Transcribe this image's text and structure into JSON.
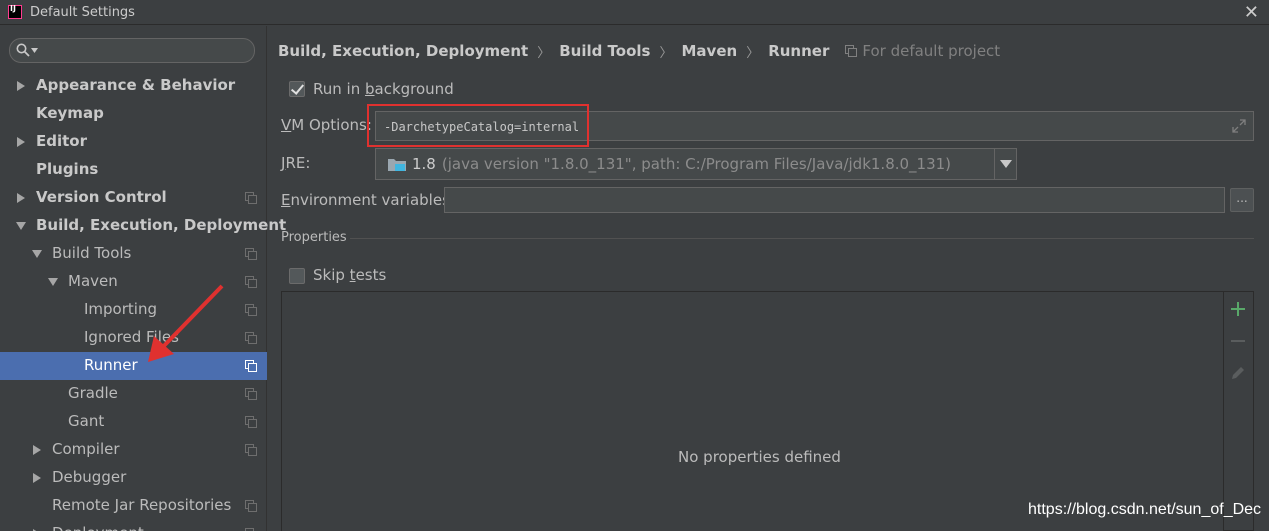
{
  "window": {
    "title": "Default Settings",
    "close_glyph": "✕"
  },
  "search": {
    "placeholder": ""
  },
  "sidebar": {
    "items": [
      {
        "label": "Appearance & Behavior",
        "bold": true,
        "arrow": "right",
        "shared": false
      },
      {
        "label": "Keymap",
        "bold": true,
        "arrow": "none",
        "shared": false
      },
      {
        "label": "Editor",
        "bold": true,
        "arrow": "right",
        "shared": false
      },
      {
        "label": "Plugins",
        "bold": true,
        "arrow": "none",
        "shared": false
      },
      {
        "label": "Version Control",
        "bold": true,
        "arrow": "right",
        "shared": true
      },
      {
        "label": "Build, Execution, Deployment",
        "bold": true,
        "arrow": "down",
        "shared": false
      },
      {
        "label": "Build Tools",
        "bold": false,
        "arrow": "down",
        "shared": true
      },
      {
        "label": "Maven",
        "bold": false,
        "arrow": "down",
        "shared": true
      },
      {
        "label": "Importing",
        "bold": false,
        "arrow": "none",
        "shared": true
      },
      {
        "label": "Ignored Files",
        "bold": false,
        "arrow": "none",
        "shared": true
      },
      {
        "label": "Runner",
        "bold": false,
        "arrow": "none",
        "shared": true,
        "selected": true
      },
      {
        "label": "Gradle",
        "bold": false,
        "arrow": "none",
        "shared": true
      },
      {
        "label": "Gant",
        "bold": false,
        "arrow": "none",
        "shared": true
      },
      {
        "label": "Compiler",
        "bold": false,
        "arrow": "right",
        "shared": true
      },
      {
        "label": "Debugger",
        "bold": false,
        "arrow": "right",
        "shared": false
      },
      {
        "label": "Remote Jar Repositories",
        "bold": false,
        "arrow": "none",
        "shared": true
      },
      {
        "label": "Deployment",
        "bold": false,
        "arrow": "right",
        "shared": true
      }
    ]
  },
  "breadcrumb": {
    "parts": [
      "Build, Execution, Deployment",
      "Build Tools",
      "Maven",
      "Runner"
    ],
    "separator": "〉",
    "scope": "For default project"
  },
  "form": {
    "run_in_background": {
      "pre": "Run in ",
      "underlined": "b",
      "post": "ackground",
      "checked": true
    },
    "vm_options": {
      "pre": "",
      "underlined": "V",
      "post": "M Options:",
      "value": "-DarchetypeCatalog=internal"
    },
    "jre": {
      "pre": "",
      "underlined": "J",
      "post": "RE:",
      "version": "1.8",
      "path": "(java version \"1.8.0_131\", path: C:/Program Files/Java/jdk1.8.0_131)"
    },
    "env_vars": {
      "pre": "",
      "underlined": "E",
      "post": "nvironment variables:",
      "value": "",
      "browse": "..."
    },
    "properties_section": "Properties",
    "skip_tests": {
      "pre": "Skip ",
      "underlined": "t",
      "post": "ests",
      "checked": false
    },
    "properties_empty": "No properties defined"
  },
  "watermark": "https://blog.csdn.net/sun_of_Dec",
  "colors": {
    "accent_selected": "#4b6eaf",
    "highlight_red": "#e0312f",
    "add_green": "#59a869"
  }
}
